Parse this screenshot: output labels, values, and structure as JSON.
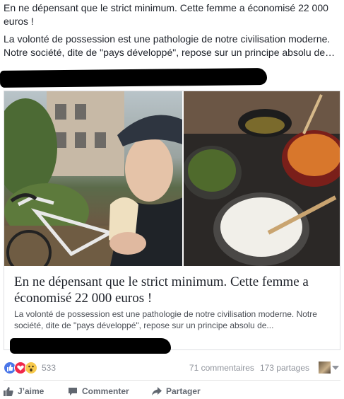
{
  "post": {
    "headline": "En ne dépensant que le strict minimum. Cette femme a économisé 22 000 euros !",
    "excerpt": "La volonté de possession est une pathologie de notre civilisation moderne. Notre société, dite de \"pays développé\", repose sur un principe absolu de…"
  },
  "card": {
    "title": "En ne dépensant que le strict minimum. Cette femme a économisé 22 000 euros !",
    "description": "La volonté de possession est une pathologie de notre civilisation moderne. Notre société, dite de \"pays développé\", repose sur un principe absolu de..."
  },
  "stats": {
    "reaction_count": "533",
    "comments": "71 commentaires",
    "shares": "173 partages"
  },
  "actions": {
    "like": "J’aime",
    "comment": "Commenter",
    "share": "Partager"
  },
  "colors": {
    "like_blue": "#4a76e8",
    "love_red": "#f0284a",
    "wow_yellow": "#f7c94c",
    "muted_text": "#90949c"
  }
}
